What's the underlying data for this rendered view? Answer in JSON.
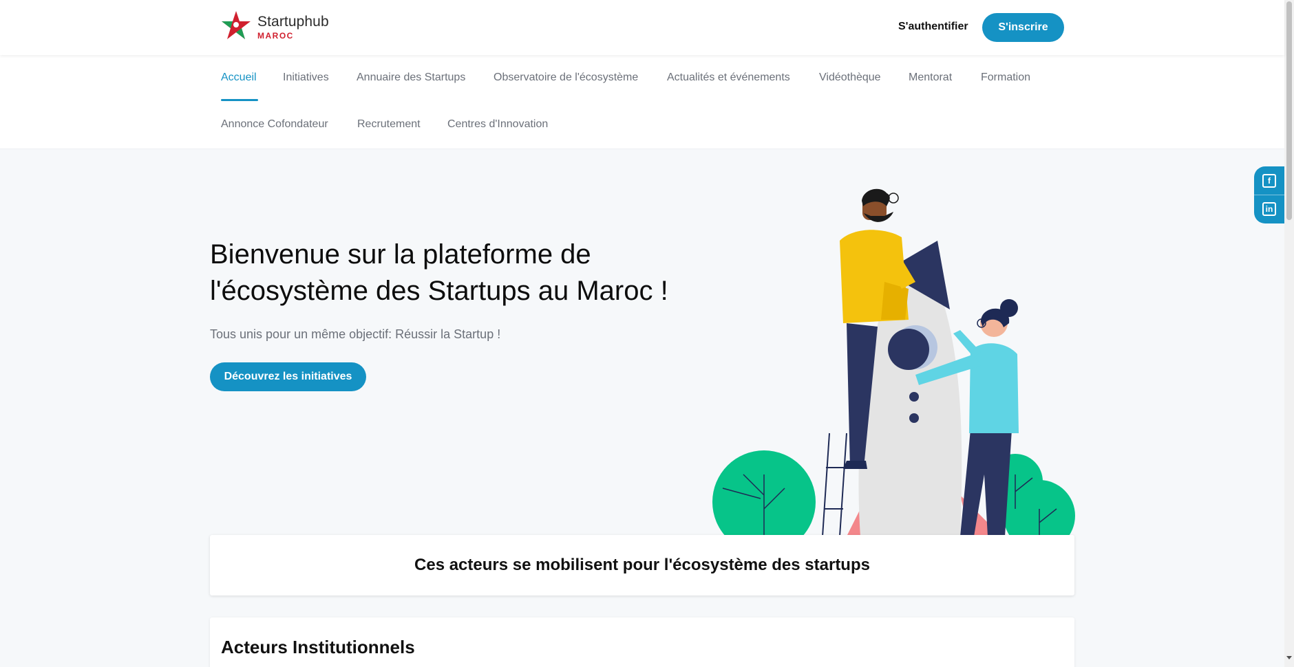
{
  "brand": {
    "name": "Startuphub",
    "sub": "MAROC"
  },
  "header": {
    "login_label": "S'authentifier",
    "signup_label": "S'inscrire"
  },
  "nav": {
    "items": [
      {
        "label": "Accueil",
        "active": true
      },
      {
        "label": "Initiatives"
      },
      {
        "label": "Annuaire des Startups"
      },
      {
        "label": "Observatoire de l'écosystème"
      },
      {
        "label": "Actualités et événements"
      },
      {
        "label": "Vidéothèque"
      },
      {
        "label": "Mentorat"
      },
      {
        "label": "Formation"
      },
      {
        "label": "Annonce Cofondateur"
      },
      {
        "label": "Recrutement"
      },
      {
        "label": "Centres d'Innovation"
      }
    ]
  },
  "hero": {
    "title_line1": "Bienvenue sur la plateforme de",
    "title_line2": "l'écosystème des Startups au Maroc !",
    "subtitle": "Tous unis pour un même objectif: Réussir la Startup !",
    "cta_label": "Découvrez les initiatives"
  },
  "social": {
    "facebook_glyph": "f",
    "linkedin_glyph": "in"
  },
  "sections": {
    "actors_title": "Ces acteurs se mobilisent pour l'écosystème des startups",
    "institutional_title": "Acteurs Institutionnels"
  },
  "colors": {
    "accent": "#1592c4",
    "brand_red": "#d0202e",
    "brand_green": "#1f9d55",
    "page_bg": "#f6f8fa"
  }
}
